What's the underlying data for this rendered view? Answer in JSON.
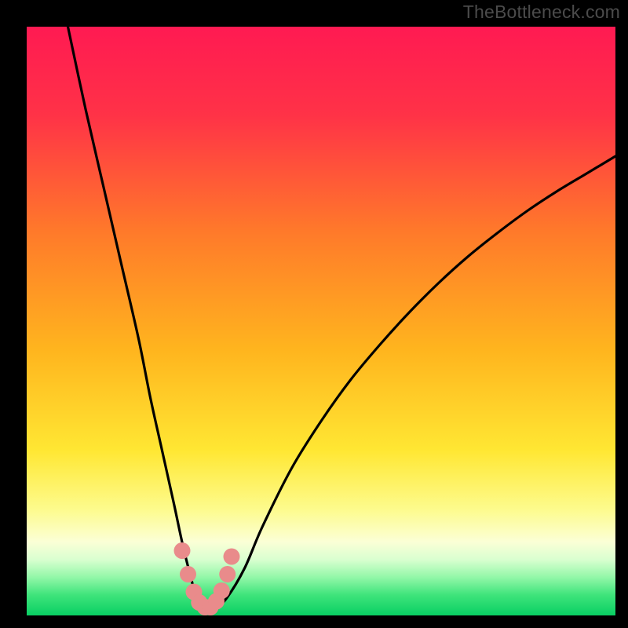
{
  "watermark": "TheBottleneck.com",
  "colors": {
    "frame": "#000000",
    "gradient_stops": [
      {
        "offset": 0.0,
        "color": "#ff1a52"
      },
      {
        "offset": 0.15,
        "color": "#ff3247"
      },
      {
        "offset": 0.35,
        "color": "#ff7a2a"
      },
      {
        "offset": 0.55,
        "color": "#ffb51e"
      },
      {
        "offset": 0.72,
        "color": "#ffe733"
      },
      {
        "offset": 0.82,
        "color": "#fdfb8d"
      },
      {
        "offset": 0.875,
        "color": "#fbffd6"
      },
      {
        "offset": 0.905,
        "color": "#d9ffd0"
      },
      {
        "offset": 0.935,
        "color": "#93f7a8"
      },
      {
        "offset": 0.965,
        "color": "#3fe47b"
      },
      {
        "offset": 1.0,
        "color": "#09cf63"
      }
    ],
    "curve": "#000000",
    "marker_fill": "#e98b8b",
    "marker_stroke": "#d06f6f"
  },
  "chart_data": {
    "type": "line",
    "title": "",
    "xlabel": "",
    "ylabel": "",
    "xlim": [
      0,
      100
    ],
    "ylim": [
      0,
      100
    ],
    "series": [
      {
        "name": "bottleneck-curve",
        "x": [
          7,
          10,
          13,
          16,
          19,
          21,
          23,
          25,
          26.5,
          28,
          29,
          30.5,
          32,
          34,
          37,
          40,
          45,
          50,
          55,
          60,
          65,
          70,
          75,
          80,
          85,
          90,
          95,
          100
        ],
        "y": [
          100,
          86,
          73,
          60,
          47,
          37,
          28,
          19,
          12,
          6,
          2.5,
          1.2,
          1.2,
          3,
          8,
          15,
          25,
          33,
          40,
          46,
          51.5,
          56.5,
          61,
          65,
          68.7,
          72,
          75,
          78
        ]
      }
    ],
    "markers": {
      "name": "highlight-points",
      "x": [
        26.4,
        27.4,
        28.4,
        29.3,
        30.3,
        31.2,
        32.2,
        33.1,
        34.1,
        34.8
      ],
      "y": [
        11.0,
        7.0,
        4.0,
        2.2,
        1.4,
        1.4,
        2.4,
        4.2,
        7.0,
        10.0
      ]
    }
  }
}
